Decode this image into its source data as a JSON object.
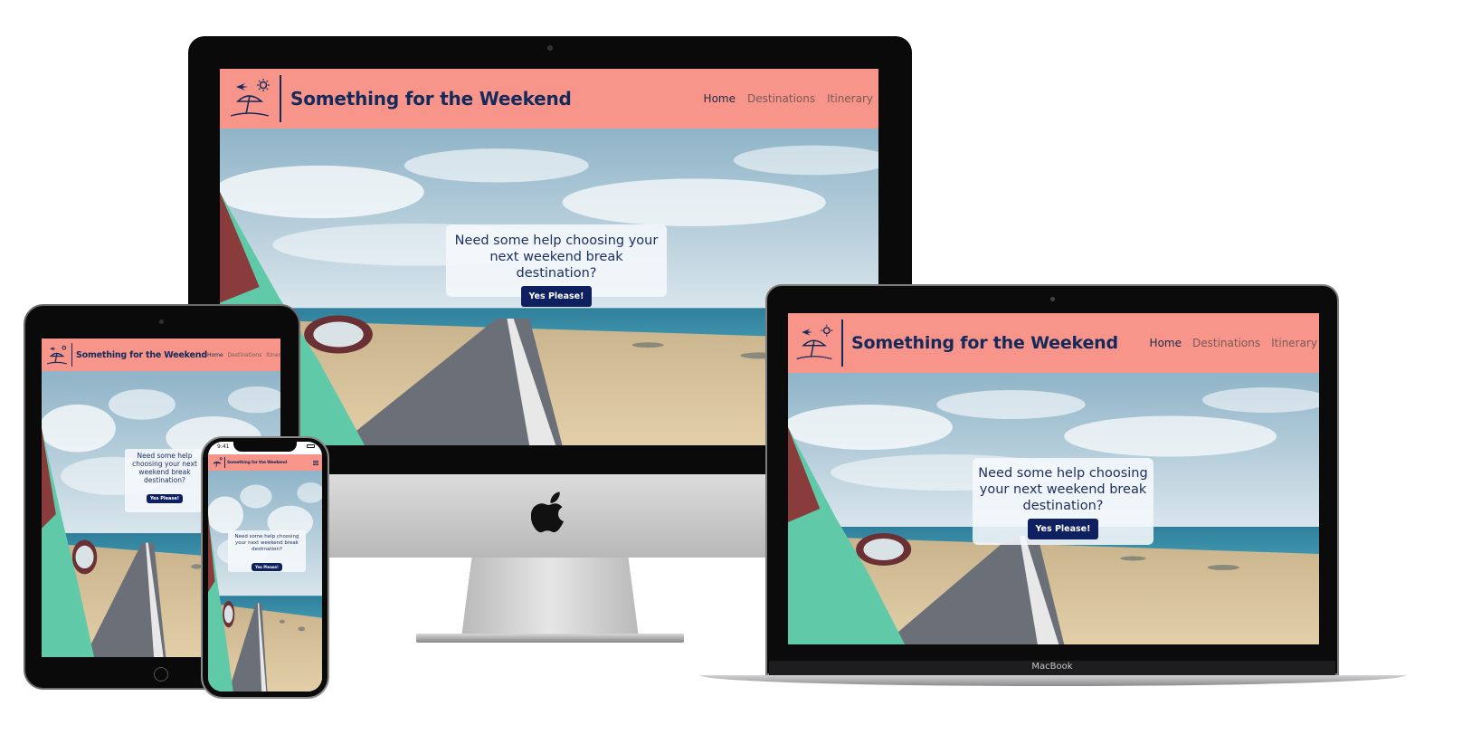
{
  "site": {
    "title": "Something for the Weekend",
    "nav": [
      "Home",
      "Destinations",
      "Itinerary"
    ],
    "hero_question": "Need some help choosing your next weekend break destination?",
    "cta_label": "Yes Please!"
  },
  "phone": {
    "time": "9:41"
  },
  "laptop": {
    "model_label": "MacBook"
  },
  "colors": {
    "header": "#f7958a",
    "brand_text": "#132a5a",
    "button": "#0f2060",
    "nav_inactive": "#7a5a58"
  },
  "icons": [
    "beach-umbrella-logo-icon",
    "airplane-icon",
    "sun-icon",
    "apple-logo-icon",
    "hamburger-menu-icon"
  ]
}
